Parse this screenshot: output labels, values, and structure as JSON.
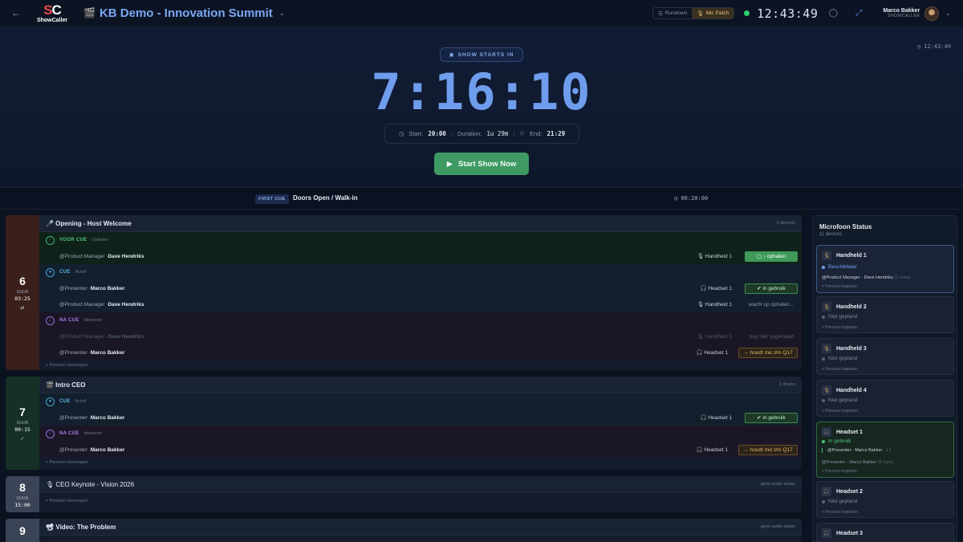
{
  "topbar": {
    "back_icon": "arrow-left-icon",
    "logo_mark_a": "S",
    "logo_mark_b": "C",
    "logo_text": "ShowCaller",
    "title": "KB Demo - Innovation Summit",
    "title_icon": "clapperboard-icon",
    "view_rundown": "Rundown",
    "view_micpatch": "Mic Patch",
    "clock": "12:43:49",
    "user_name": "Marco Bakker",
    "user_role": "SHOWCALLER",
    "accent": "#7aa7f3"
  },
  "hero": {
    "pill_label": "SHOW STARTS IN",
    "side_clock": "12:43:49",
    "countdown": "7:16:10",
    "start_label": "Start:",
    "start_value": "20:00",
    "duration_label": "Duration:",
    "duration_value": "1u 29m",
    "end_label": "End:",
    "end_value": "21:29",
    "start_button": "Start Show Now"
  },
  "first_cue": {
    "tag": "FIRST CUE",
    "name": "Doors Open / Walk-in",
    "duration": "00:20:00"
  },
  "rundown": {
    "c6": {
      "number": "6",
      "dur_label": "DUUR",
      "time": "03:25",
      "mini": "⇄",
      "name": "🎤 Opening - Host Welcome",
      "devices": "2 devices",
      "voor_label": "VOOR CUE",
      "voor_sub": "Ophalen",
      "r1_role": "@Product Manager · ",
      "r1_who": "Dave Hendriks",
      "r1_dev": "🎙 Handheld 1",
      "r1_stat": "▢ ↑ ophalen",
      "cue_label": "CUE",
      "cue_sub": "Actief",
      "r2_role": "@Presenter · ",
      "r2_who": "Marco Bakker",
      "r2_dev": "🎧 Headset 1",
      "r2_stat": "✔ in gebruik",
      "r3_role": "@Product Manager · ",
      "r3_who": "Dave Hendriks",
      "r3_dev": "🎙 Handheld 1",
      "r3_stat": "wacht op ophalen...",
      "na_label": "NA CUE",
      "na_sub": "Inleveren",
      "r4_role": "@Product Manager · ",
      "r4_who": "Dave Hendriks",
      "r4_dev": "🎙 Handheld 1",
      "r4_stat": "nog niet opgehaald",
      "r5_role": "@Presenter · ",
      "r5_who": "Marco Bakker",
      "r5_dev": "🎧 Headset 1",
      "r5_stat": "→ houdt mic t/m Q17",
      "add": "+ Persoon toevoegen"
    },
    "c7": {
      "number": "7",
      "dur_label": "DUUR",
      "time": "00:15",
      "mini": "✓",
      "name": "🎬 Intro CEO",
      "devices": "1 device",
      "cue_label": "CUE",
      "cue_sub": "Actief",
      "r1_role": "@Presenter · ",
      "r1_who": "Marco Bakker",
      "r1_dev": "🎧 Headset 1",
      "r1_stat": "✔ in gebruik",
      "na_label": "NA CUE",
      "na_sub": "Inleveren",
      "r2_role": "@Presenter · ",
      "r2_who": "Marco Bakker",
      "r2_dev": "🎧 Headset 1",
      "r2_stat": "→ houdt mic t/m Q17",
      "add": "+ Persoon toevoegen"
    },
    "c8": {
      "number": "8",
      "dur_label": "DUUR",
      "time": "15:00",
      "name": "🎙 CEO Keynote - Vision 2026",
      "devices": "geen audio acties",
      "add": "+ Persoon toevoegen"
    },
    "c9": {
      "number": "9",
      "name": "📽 Video: The Problem",
      "devices": "geen audio acties"
    }
  },
  "mic_panel": {
    "title": "Microfoon Status",
    "count": "11 devices",
    "h1": {
      "name": "Handheld 1",
      "status": "Beschikbaar",
      "owner_role": "@Product Manager · ",
      "owner": "Dave Hendriks",
      "owner_note": "(1 cues)",
      "link": "+ Persoon koppelen"
    },
    "h2": {
      "name": "Handheld 2",
      "status": "Niet gepland",
      "link": "+ Persoon koppelen"
    },
    "h3": {
      "name": "Handheld 3",
      "status": "Niet gepland",
      "link": "+ Persoon koppelen"
    },
    "h4": {
      "name": "Handheld 4",
      "status": "Niet gepland",
      "link": "+ Persoon koppelen"
    },
    "s1": {
      "name": "Headset 1",
      "status": "In gebruik",
      "current": "@Presenter · Marco Bakker",
      "current_note": "· 17",
      "owner": "@Presenter · Marco Bakker",
      "owner_note": "(6 cues)",
      "link": "+ Persoon koppelen"
    },
    "s2": {
      "name": "Headset 2",
      "status": "Niet gepland",
      "link": "+ Persoon koppelen"
    },
    "s3": {
      "name": "Headset 3"
    }
  }
}
